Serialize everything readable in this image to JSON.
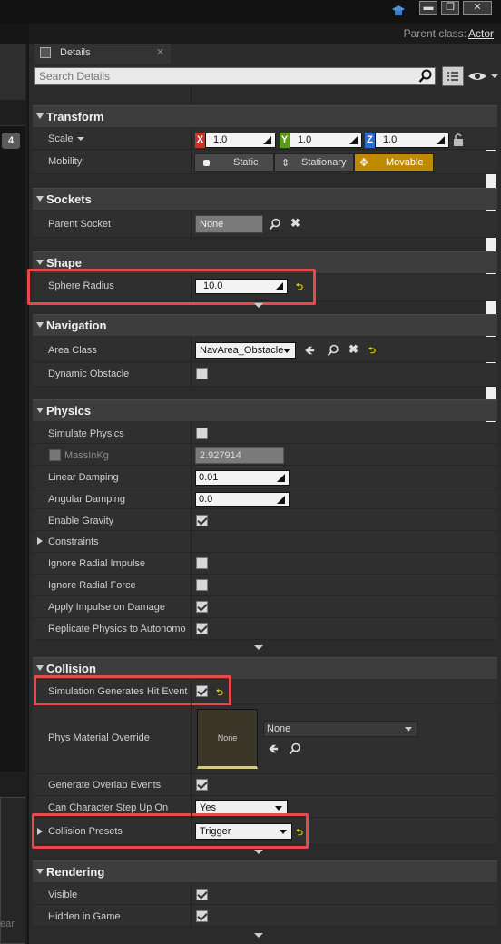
{
  "window": {
    "controls": [
      "minimize",
      "maximize",
      "close"
    ]
  },
  "header": {
    "parent_class_label": "Parent class:",
    "parent_class_value": "Actor"
  },
  "left": {
    "badge": "4",
    "bottom_text": "ear"
  },
  "tab": {
    "label": "Details",
    "close": "✕"
  },
  "search": {
    "placeholder": "Search Details"
  },
  "transform": {
    "title": "Transform",
    "scale_label": "Scale",
    "x": "1.0",
    "y": "1.0",
    "z": "1.0",
    "mobility_label": "Mobility",
    "mobility_options": [
      "Static",
      "Stationary",
      "Movable"
    ],
    "mobility_selected": "Movable"
  },
  "sockets": {
    "title": "Sockets",
    "parent_socket_label": "Parent Socket",
    "parent_socket_value": "None"
  },
  "shape": {
    "title": "Shape",
    "sphere_radius_label": "Sphere Radius",
    "sphere_radius_value": "10.0"
  },
  "navigation": {
    "title": "Navigation",
    "area_class_label": "Area Class",
    "area_class_value": "NavArea_Obstacle",
    "dynamic_obstacle_label": "Dynamic Obstacle"
  },
  "physics": {
    "title": "Physics",
    "simulate_physics": "Simulate Physics",
    "mass_label": "MassInKg",
    "mass_value": "2.927914",
    "linear_damping": "Linear Damping",
    "linear_damping_value": "0.01",
    "angular_damping": "Angular Damping",
    "angular_damping_value": "0.0",
    "enable_gravity": "Enable Gravity",
    "constraints": "Constraints",
    "ignore_radial_impulse": "Ignore Radial Impulse",
    "ignore_radial_force": "Ignore Radial Force",
    "apply_impulse_on_damage": "Apply Impulse on Damage",
    "replicate_physics": "Replicate Physics to Autonomo"
  },
  "collision": {
    "title": "Collision",
    "sim_hit_event": "Simulation Generates Hit Event",
    "phys_material_label": "Phys Material Override",
    "phys_material_thumb": "None",
    "phys_material_value": "None",
    "gen_overlap": "Generate Overlap Events",
    "step_up_label": "Can Character Step Up On",
    "step_up_value": "Yes",
    "presets_label": "Collision Presets",
    "presets_value": "Trigger"
  },
  "rendering": {
    "title": "Rendering",
    "visible": "Visible",
    "hidden_in_game": "Hidden in Game"
  },
  "colors": {
    "accent": "#c08a00",
    "highlight": "#e84a4a",
    "reset": "#e6d300"
  }
}
